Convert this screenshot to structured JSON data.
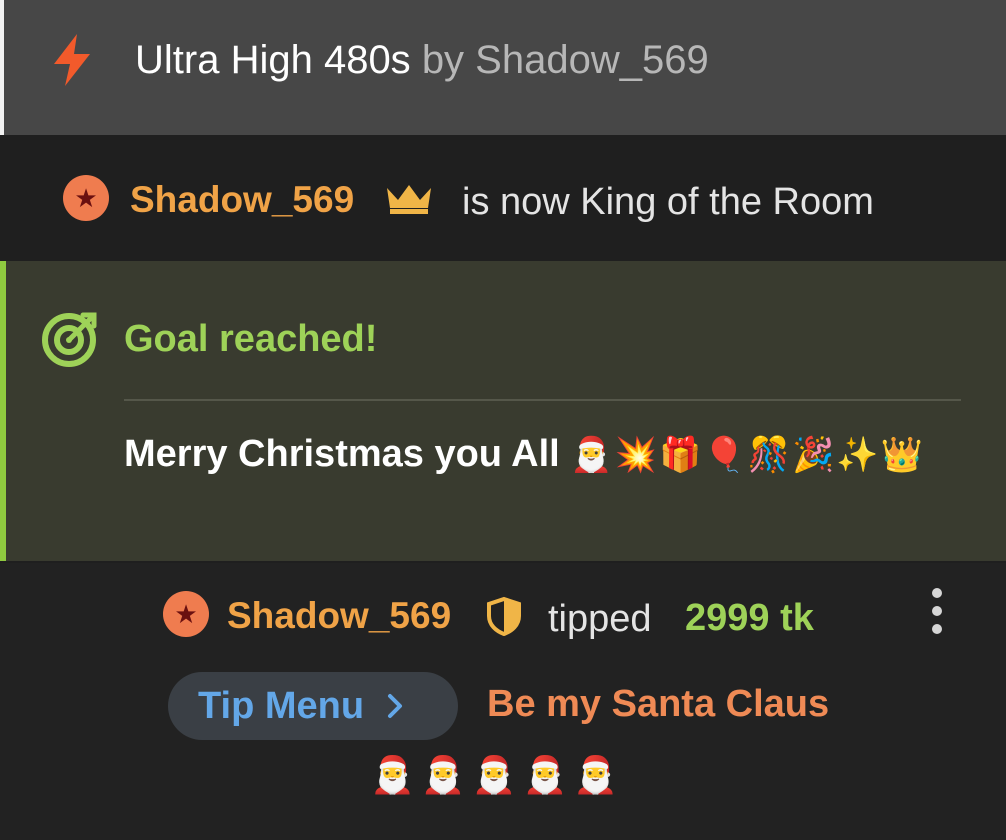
{
  "header": {
    "icon": "lightning-bolt-icon",
    "accent_color": "#f25a2b",
    "room_title": "Ultra High 480s",
    "by_text": "by Shadow_569"
  },
  "king_notice": {
    "user_badge_icon": "star-badge-icon",
    "username": "Shadow_569",
    "crown_icon": "crown-icon",
    "message": "is now King of the Room"
  },
  "goal": {
    "icon": "target-icon",
    "accent_color": "#8fca3f",
    "title": "Goal reached!",
    "message": "Merry Christmas you All",
    "emojis": "🎅💥🎁🎈🎊🎉✨👑"
  },
  "tip_event": {
    "user_badge_icon": "star-badge-icon",
    "username": "Shadow_569",
    "shield_icon": "shield-icon",
    "action": "tipped",
    "amount": "2999 tk",
    "more_icon": "kebab-menu-icon",
    "tip_menu_label": "Tip Menu",
    "tip_menu_icon": "chevron-right-icon",
    "tip_item": "Be my Santa Claus",
    "tip_emojis": "🎅🎅🎅🎅🎅"
  }
}
